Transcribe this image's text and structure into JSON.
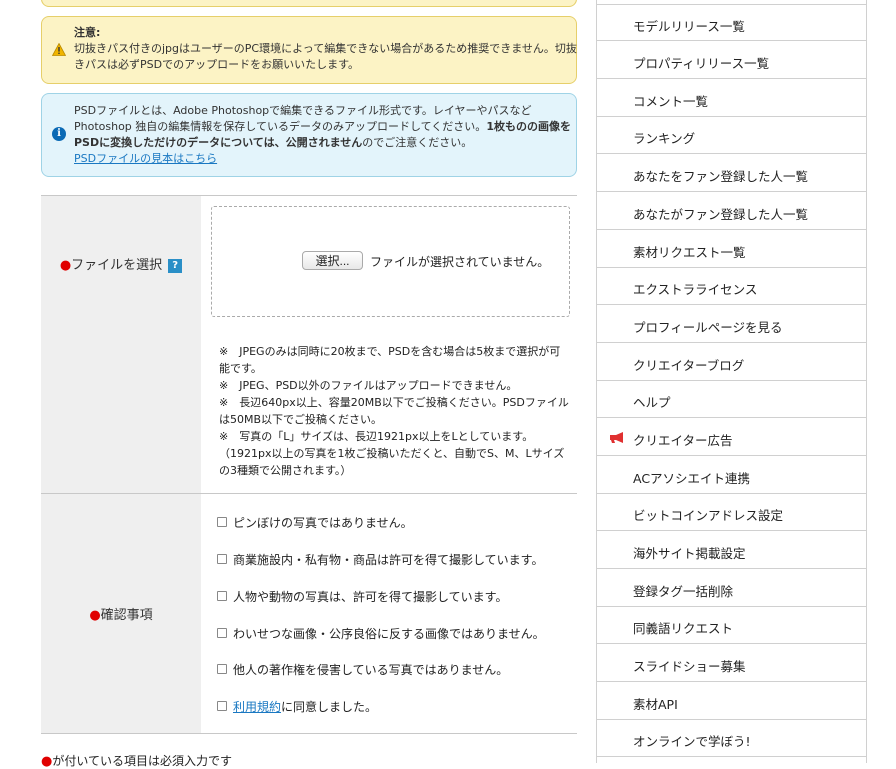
{
  "alerts": {
    "warning": {
      "title": "注意:",
      "line1": "切抜きパス付きのjpgはユーザーのPC環境によって編集できない場合があるため推奨できません。切抜",
      "line2": "きパスは必ずPSDでのアップロードをお願いいたします。"
    },
    "info": {
      "line1": "PSDファイルとは、Adobe Photoshopで編集できるファイル形式です。レイヤーやパスなど",
      "line2_normal": "Photoshop 独自の編集情報を保存しているデータのみアップロードしてください。",
      "line2_bold": "1枚ものの画像を",
      "line3_bold": "PSDに変換しただけのデータについては、公開されません",
      "line3_normal": "のでご注意ください。",
      "link": "PSDファイルの見本はこちら"
    }
  },
  "form": {
    "required_mark": "●",
    "file_label": "ファイルを選択",
    "help_icon_text": "?",
    "choose_button": "選択...",
    "no_file_text": "ファイルが選択されていません。",
    "notes": [
      "※　JPEGのみは同時に20枚まで、PSDを含む場合は5枚まで選択が可能です。",
      "※　JPEG、PSD以外のファイルはアップロードできません。",
      "※　長辺640px以上、容量20MB以下でご投稿ください。PSDファイルは50MB以下でご投稿ください。",
      "※　写真の「L」サイズは、長辺1921px以上をLとしています。（1921px以上の写真を1枚ご投稿いただくと、自動でS、M、Lサイズの3種類で公開されます。）"
    ],
    "confirm_label": "確認事項",
    "checks": [
      "ピンぼけの写真ではありません。",
      "商業施設内・私有物・商品は許可を得て撮影しています。",
      "人物や動物の写真は、許可を得て撮影しています。",
      "わいせつな画像・公序良俗に反する画像ではありません。",
      "他人の著作権を侵害している写真ではありません。"
    ],
    "terms_link": "利用規約",
    "terms_suffix": "に同意しました。",
    "footnote": "が付いている項目は必須入力です"
  },
  "sidebar": {
    "items": [
      "モデルリリース一覧",
      "プロパティリリース一覧",
      "コメント一覧",
      "ランキング",
      "あなたをファン登録した人一覧",
      "あなたがファン登録した人一覧",
      "素材リクエスト一覧",
      "エクストラライセンス",
      "プロフィールページを見る",
      "クリエイターブログ",
      "ヘルプ",
      "クリエイター広告",
      "ACアソシエイト連携",
      "ビットコインアドレス設定",
      "海外サイト掲載設定",
      "登録タグ一括削除",
      "同義語リクエスト",
      "スライドショー募集",
      "素材API",
      "オンラインで学ぼう!"
    ]
  },
  "colors": {
    "warning_bg": "#fcf3c5",
    "info_bg": "#e3f4fb",
    "required": "#e00000",
    "link": "#1a78c2",
    "ad_icon": "#e03030"
  }
}
